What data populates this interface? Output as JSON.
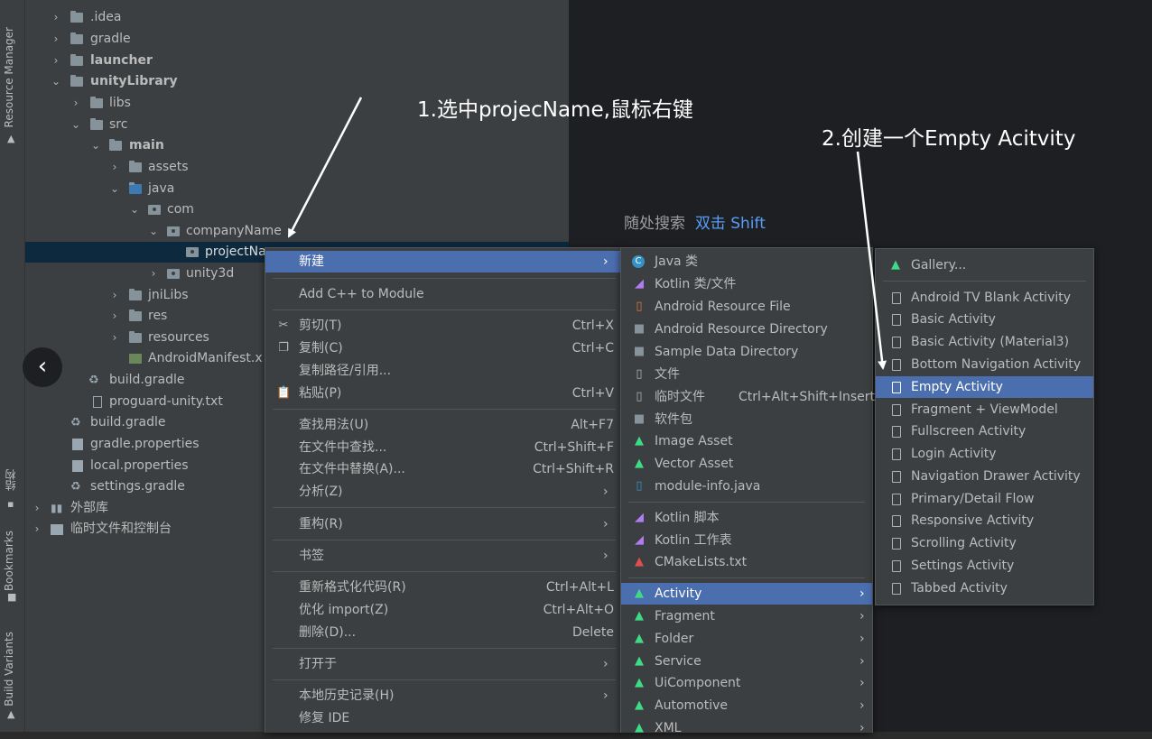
{
  "side_strip": {
    "resource_manager": "Resource Manager",
    "structure": "结构",
    "bookmarks": "Bookmarks",
    "build_variants": "Build Variants"
  },
  "tree": {
    "idea": ".idea",
    "gradle": "gradle",
    "launcher": "launcher",
    "unityLibrary": "unityLibrary",
    "libs": "libs",
    "src": "src",
    "main": "main",
    "assets": "assets",
    "java": "java",
    "com": "com",
    "companyName": "companyName",
    "projectName": "projectNa",
    "unity3d": "unity3d",
    "jniLibs": "jniLibs",
    "res": "res",
    "resources": "resources",
    "manifest": "AndroidManifest.x",
    "build_gradle_inner": "build.gradle",
    "proguard": "proguard-unity.txt",
    "build_gradle": "build.gradle",
    "gradle_properties": "gradle.properties",
    "local_properties": "local.properties",
    "settings_gradle": "settings.gradle",
    "external_libs": "外部库",
    "scratches": "临时文件和控制台"
  },
  "annotations": {
    "step1": "1.选中projecName,鼠标右键",
    "step2": "2.创建一个Empty Acitvity"
  },
  "search_hint": {
    "text": "随处搜索",
    "key": "双击 Shift"
  },
  "context_menu": {
    "items": [
      {
        "label": "新建",
        "shortcut": "",
        "submenu": true
      },
      {
        "label": "Add C++ to Module",
        "shortcut": ""
      },
      {
        "label": "剪切(T)",
        "shortcut": "Ctrl+X"
      },
      {
        "label": "复制(C)",
        "shortcut": "Ctrl+C"
      },
      {
        "label": "复制路径/引用...",
        "shortcut": ""
      },
      {
        "label": "粘贴(P)",
        "shortcut": "Ctrl+V"
      },
      {
        "label": "查找用法(U)",
        "shortcut": "Alt+F7"
      },
      {
        "label": "在文件中查找...",
        "shortcut": "Ctrl+Shift+F"
      },
      {
        "label": "在文件中替换(A)...",
        "shortcut": "Ctrl+Shift+R"
      },
      {
        "label": "分析(Z)",
        "shortcut": "",
        "submenu": true
      },
      {
        "label": "重构(R)",
        "shortcut": "",
        "submenu": true
      },
      {
        "label": "书签",
        "shortcut": "",
        "submenu": true
      },
      {
        "label": "重新格式化代码(R)",
        "shortcut": "Ctrl+Alt+L"
      },
      {
        "label": "优化 import(Z)",
        "shortcut": "Ctrl+Alt+O"
      },
      {
        "label": "删除(D)...",
        "shortcut": "Delete"
      },
      {
        "label": "打开于",
        "shortcut": "",
        "submenu": true
      },
      {
        "label": "本地历史记录(H)",
        "shortcut": "",
        "submenu": true
      },
      {
        "label": "修复 IDE",
        "shortcut": ""
      }
    ]
  },
  "new_menu": {
    "items": [
      {
        "label": "Java 类",
        "shortcut": ""
      },
      {
        "label": "Kotlin 类/文件",
        "shortcut": ""
      },
      {
        "label": "Android Resource File",
        "shortcut": ""
      },
      {
        "label": "Android Resource Directory",
        "shortcut": ""
      },
      {
        "label": "Sample Data Directory",
        "shortcut": ""
      },
      {
        "label": "文件",
        "shortcut": ""
      },
      {
        "label": "临时文件",
        "shortcut": "Ctrl+Alt+Shift+Insert"
      },
      {
        "label": "软件包",
        "shortcut": ""
      },
      {
        "label": "Image Asset",
        "shortcut": ""
      },
      {
        "label": "Vector Asset",
        "shortcut": ""
      },
      {
        "label": "module-info.java",
        "shortcut": ""
      },
      {
        "label": "Kotlin 脚本",
        "shortcut": ""
      },
      {
        "label": "Kotlin 工作表",
        "shortcut": ""
      },
      {
        "label": "CMakeLists.txt",
        "shortcut": ""
      },
      {
        "label": "Activity",
        "shortcut": ""
      },
      {
        "label": "Fragment",
        "shortcut": ""
      },
      {
        "label": "Folder",
        "shortcut": ""
      },
      {
        "label": "Service",
        "shortcut": ""
      },
      {
        "label": "UiComponent",
        "shortcut": ""
      },
      {
        "label": "Automotive",
        "shortcut": ""
      },
      {
        "label": "XML",
        "shortcut": ""
      }
    ]
  },
  "activity_menu": {
    "items": [
      "Gallery...",
      "Android TV Blank Activity",
      "Basic Activity",
      "Basic Activity (Material3)",
      "Bottom Navigation Activity",
      "Empty Activity",
      "Fragment + ViewModel",
      "Fullscreen Activity",
      "Login Activity",
      "Navigation Drawer Activity",
      "Primary/Detail Flow",
      "Responsive Activity",
      "Scrolling Activity",
      "Settings Activity",
      "Tabbed Activity"
    ]
  },
  "colors": {
    "highlight": "#4b6eaf",
    "android_green": "#3ddc84",
    "search_key": "#589df6"
  }
}
